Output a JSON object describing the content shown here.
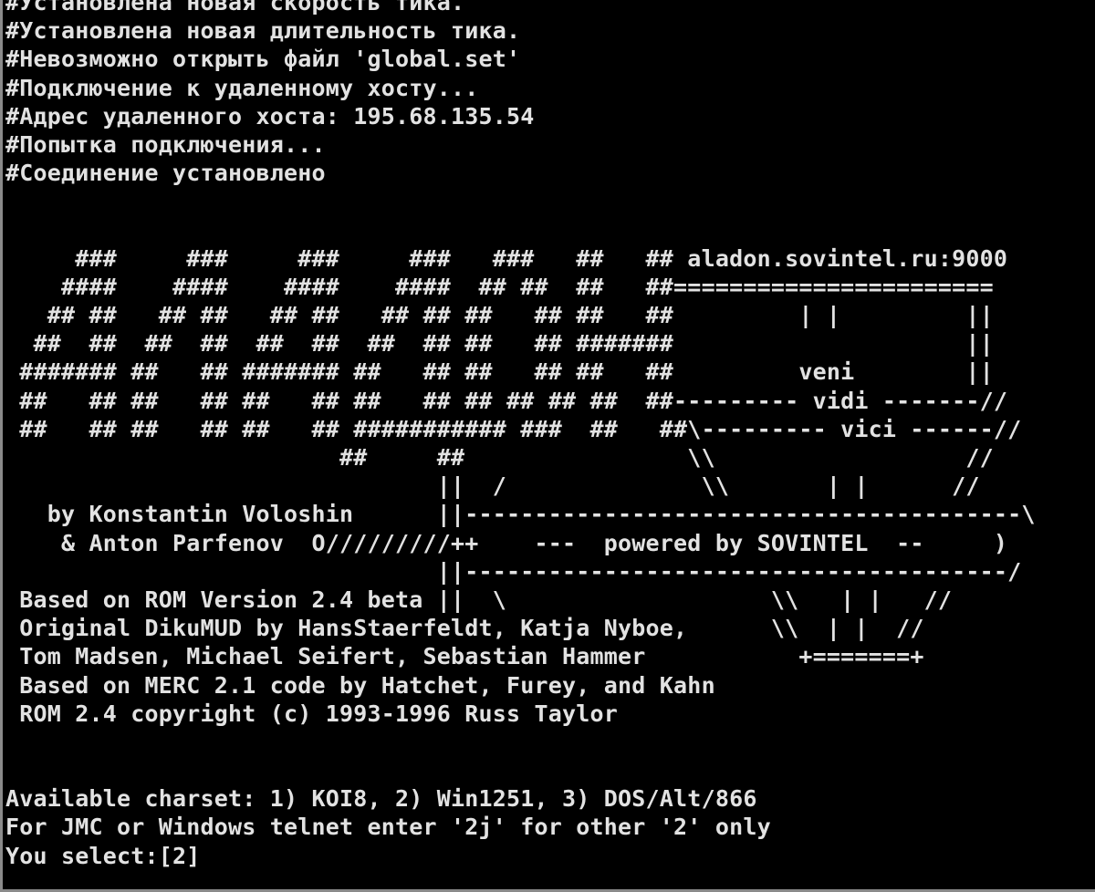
{
  "colors": {
    "background": "#000000",
    "text": "#e2e2e2",
    "frame": "#8a8a8a"
  },
  "terminal": {
    "lines": [
      "#Установлена новая скорость тика.",
      "#Установлена новая длительность тика.",
      "#Невозможно открыть файл 'global.set'",
      "#Подключение к удаленному хосту...",
      "#Адрес удаленного хоста: 195.68.135.54",
      "#Попытка подключения...",
      "#Соединение установлено",
      "",
      "",
      "     ###     ###     ###     ###   ###   ##   ## aladon.sovintel.ru:9000",
      "    ####    ####    ####    ####  ## ##  ##   ##=======================",
      "   ## ##   ## ##   ## ##   ## ## ##   ## ##   ##         | |         ||",
      "  ##  ##  ##  ##  ##  ##  ##  ## ##   ## #######                     ||",
      " ####### ##   ## ####### ##   ## ##   ## ##   ##         veni        ||",
      " ##   ## ##   ## ##   ## ##   ## ## ## ## ##  ##--------- vidi -------//",
      " ##   ## ##   ## ##   ## ########### ###  ##   ##\\--------- vici ------//",
      "                        ##     ##                \\\\                  //",
      "                               ||  /              \\\\       | |      //",
      "   by Konstantin Voloshin      ||----------------------------------------\\",
      "    & Anton Parfenov  O/////////++    ---  powered by SOVINTEL  --     )",
      "                               ||---------------------------------------/",
      " Based on ROM Version 2.4 beta ||  \\                   \\\\   | |   //",
      " Original DikuMUD by HansStaerfeldt, Katja Nyboe,      \\\\  | |  //",
      " Tom Madsen, Michael Seifert, Sebastian Hammer           +=======+",
      " Based on MERC 2.1 code by Hatchet, Furey, and Kahn",
      " ROM 2.4 copyright (c) 1993-1996 Russ Taylor",
      "",
      "",
      "Available charset: 1) KOI8, 2) Win1251, 3) DOS/Alt/866",
      "For JMC or Windows telnet enter '2j' for other '2' only"
    ],
    "prompt": "You select:",
    "input_value": "[2]"
  }
}
